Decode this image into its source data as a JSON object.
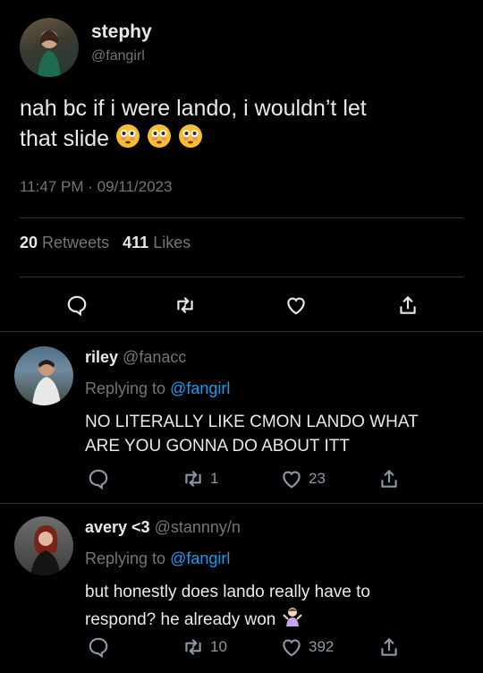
{
  "main_tweet": {
    "name": "stephy",
    "handle": "@fangirl",
    "text": "nah bc if i were lando, i wouldn’t let",
    "text_line2": "that slide",
    "time": "11:47 PM",
    "date": "09/11/2023",
    "retweets_count": "20",
    "retweets_label": "Retweets",
    "likes_count": "411",
    "likes_label": "Likes",
    "emoji_icon": "flushed-face-icon"
  },
  "replies": [
    {
      "name": "riley",
      "handle": "@fanacc",
      "replying_prefix": "Replying to",
      "replying_handle": "@fangirl",
      "text_line1": "NO LITERALLY LIKE CMON LANDO WHAT",
      "text_line2": "ARE YOU GONNA DO ABOUT ITT",
      "retweets": "1",
      "likes": "23"
    },
    {
      "name": "avery <3",
      "handle": "@stannny/n",
      "replying_prefix": "Replying to",
      "replying_handle": "@fangirl",
      "text_line1": "but honestly does lando really have to",
      "text_line2": "respond? he already won",
      "retweets": "10",
      "likes": "392",
      "emoji_icon": "person-shrugging-icon"
    }
  ],
  "colors": {
    "background": "#000000",
    "text": "#e7e9ea",
    "muted": "#71767b",
    "link": "#1d9bf0",
    "separator": "#2f3336"
  }
}
